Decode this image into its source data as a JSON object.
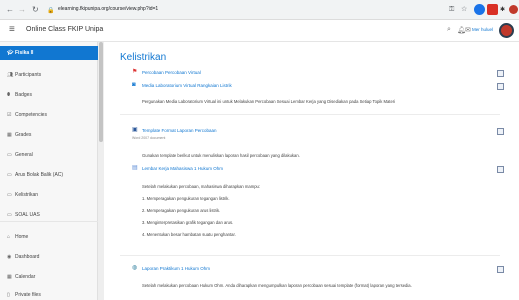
{
  "browser": {
    "url": "elearning.fkipunipa.org/course/view.php?id=1"
  },
  "header": {
    "title": "Online Class FKIP Unipa",
    "user_name": "Mer huluel"
  },
  "sidebar": {
    "items": [
      {
        "label": "Fisika II",
        "icon": "graduation-cap-icon"
      },
      {
        "label": "Participants",
        "icon": "users-icon"
      },
      {
        "label": "Badges",
        "icon": "badge-icon"
      },
      {
        "label": "Competencies",
        "icon": "competencies-icon"
      },
      {
        "label": "Grades",
        "icon": "grades-icon"
      },
      {
        "label": "General",
        "icon": "folder-icon"
      },
      {
        "label": "Arus Bolak Balik (AC)",
        "icon": "folder-icon"
      },
      {
        "label": "Kelistrikan",
        "icon": "folder-icon"
      },
      {
        "label": "SOAL UAS",
        "icon": "folder-icon"
      },
      {
        "label": "Home",
        "icon": "home-icon"
      },
      {
        "label": "Dashboard",
        "icon": "dashboard-icon"
      },
      {
        "label": "Calendar",
        "icon": "calendar-icon"
      },
      {
        "label": "Private files",
        "icon": "file-icon"
      }
    ]
  },
  "main": {
    "title": "Kelistrikan",
    "activities": [
      {
        "title": "Percobaan Percobaan Virtual",
        "icon": "percobaan-icon"
      },
      {
        "title": "Media Laboratorium Virtual Rangkaian Listrik",
        "icon": "url-link-icon"
      },
      {
        "title": "Template Format Laporan Percobaan",
        "sub": "Word 2007 document",
        "icon": "word-document-icon"
      },
      {
        "title": "Lembar Kerja Mahasiswa 1 Hukum Ohm",
        "icon": "page-icon"
      },
      {
        "title": "Laporan Praktikum 1 Hukum Ohm",
        "icon": "assignment-icon"
      }
    ],
    "desc_media": "Pergunakan Media Laboratorium Virtual ini untuk Melakukan Percobaan Sesuai Lembar Kerja yang Disediakan pada Setiap Topik Materi",
    "desc_template": "Gunakan template berikut untuk menuliskan laporan hasil percobaan yang dilakukan.",
    "lkm_intro": "Setelah melakukan percobaan, mahasiswa diharapkan mampu:",
    "lkm_items": [
      "1. Memperagakan pengukuran tegangan listrik.",
      "2. Memperagakan pengukuran arus listrik.",
      "3. Menginterpretasikan grafik tegangan dan arus.",
      "4. Menentukan besar hambatan suatu penghantar."
    ],
    "desc_laporan": "Setelah melakukan percobaan Hukum Ohm. Anda diharapkan mengumpulkan laporan percobaan sesuai template (format) laporan yang tersedia."
  }
}
